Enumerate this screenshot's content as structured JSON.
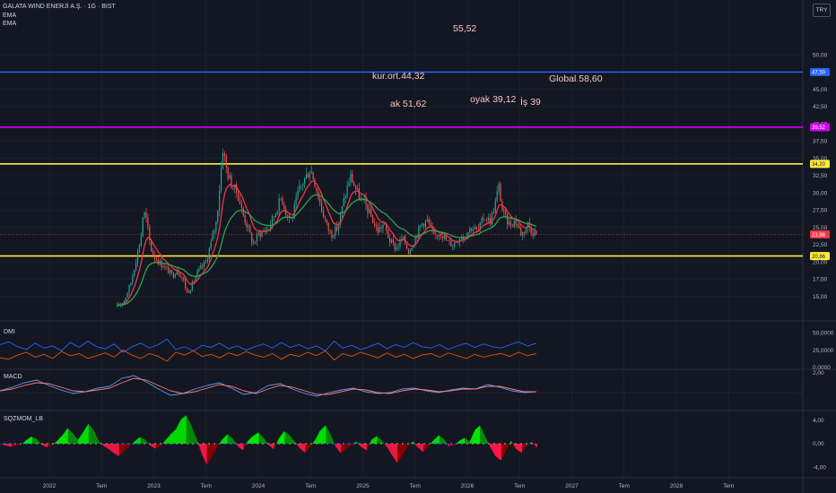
{
  "header": {
    "symbol": "GALATA WIND ENERJİ A.Ş. · 1G · BIST",
    "ind1": "EMA",
    "ind2": "EMA",
    "currency": "TRY"
  },
  "colors": {
    "background": "#131722",
    "grid": "#1e222d",
    "candle_up": "#26a69a",
    "candle_down": "#ef5350",
    "ema_fast": "#f23645",
    "ema_slow": "#2ea44f",
    "blue_line": "#2962ff",
    "purple_line": "#d500f9",
    "yellow_line": "#ffeb3b",
    "dmi_plus": "#2962ff",
    "dmi_minus": "#e65100",
    "macd": "#5b9cf6",
    "signal": "#ff7a7a",
    "sqz_up": "#00e600",
    "sqz_down": "#ff1744"
  },
  "chart_data": [
    {
      "type": "candlestick",
      "title": "GALATA WIND ENERJİ A.Ş. · 1G · BIST",
      "x_ticks": [
        "2022",
        "Tem",
        "2023",
        "Tem",
        "2024",
        "Tem",
        "2025",
        "Tem",
        "2026",
        "Tem",
        "2027",
        "Tem",
        "2028",
        "Tem"
      ],
      "y_ticks": [
        "50,00",
        "47,50",
        "45,00",
        "42,50",
        "40,00",
        "37,50",
        "35,00",
        "32,50",
        "30,00",
        "27,50",
        "25,00",
        "22,50",
        "20,00",
        "17,50",
        "15,00"
      ],
      "ylim": [
        12.5,
        53
      ],
      "price_path": [
        [
          2022.65,
          13.5
        ],
        [
          2022.72,
          14.5
        ],
        [
          2022.78,
          17
        ],
        [
          2022.84,
          21
        ],
        [
          2022.88,
          24
        ],
        [
          2022.9,
          27.5
        ],
        [
          2022.93,
          26
        ],
        [
          2022.97,
          22
        ],
        [
          2023.0,
          21
        ],
        [
          2023.05,
          20
        ],
        [
          2023.12,
          19
        ],
        [
          2023.18,
          18
        ],
        [
          2023.22,
          19
        ],
        [
          2023.28,
          17.5
        ],
        [
          2023.32,
          15.5
        ],
        [
          2023.36,
          16.5
        ],
        [
          2023.42,
          18.5
        ],
        [
          2023.5,
          20
        ],
        [
          2023.55,
          23
        ],
        [
          2023.6,
          26
        ],
        [
          2023.63,
          31
        ],
        [
          2023.66,
          36.5
        ],
        [
          2023.7,
          33
        ],
        [
          2023.75,
          31
        ],
        [
          2023.8,
          30
        ],
        [
          2023.85,
          27
        ],
        [
          2023.9,
          25
        ],
        [
          2023.95,
          22.5
        ],
        [
          2024.0,
          24
        ],
        [
          2024.05,
          24.5
        ],
        [
          2024.1,
          25
        ],
        [
          2024.16,
          27
        ],
        [
          2024.22,
          29.5
        ],
        [
          2024.27,
          27
        ],
        [
          2024.32,
          26
        ],
        [
          2024.38,
          30
        ],
        [
          2024.44,
          32
        ],
        [
          2024.5,
          33.5
        ],
        [
          2024.55,
          31
        ],
        [
          2024.6,
          28
        ],
        [
          2024.66,
          25
        ],
        [
          2024.7,
          24
        ],
        [
          2024.76,
          25
        ],
        [
          2024.82,
          29
        ],
        [
          2024.88,
          32.5
        ],
        [
          2024.92,
          31
        ],
        [
          2024.98,
          29
        ],
        [
          2025.02,
          28.5
        ],
        [
          2025.08,
          26.5
        ],
        [
          2025.14,
          24.5
        ],
        [
          2025.2,
          25.5
        ],
        [
          2025.26,
          23
        ],
        [
          2025.32,
          22
        ],
        [
          2025.38,
          23.5
        ],
        [
          2025.44,
          21.5
        ],
        [
          2025.5,
          23.5
        ],
        [
          2025.56,
          25.5
        ],
        [
          2025.62,
          26
        ],
        [
          2025.68,
          23.5
        ],
        [
          2025.74,
          24.5
        ],
        [
          2025.8,
          23
        ],
        [
          2025.86,
          22.5
        ],
        [
          2025.92,
          23.5
        ],
        [
          2025.98,
          24
        ],
        [
          2026.04,
          25
        ],
        [
          2026.1,
          24.5
        ],
        [
          2026.16,
          26.5
        ],
        [
          2026.22,
          26
        ],
        [
          2026.26,
          28
        ],
        [
          2026.3,
          31
        ],
        [
          2026.34,
          27
        ],
        [
          2026.4,
          25.5
        ],
        [
          2026.46,
          26
        ],
        [
          2026.52,
          24
        ],
        [
          2026.58,
          25.5
        ],
        [
          2026.62,
          24.5
        ],
        [
          2026.66,
          23.98
        ]
      ],
      "current_price": "23,98",
      "annotations": [
        "55,52",
        "kur.ort.44,32",
        "Global 58,60",
        "ak 51,62",
        "oyak 39,12",
        "İş 39"
      ],
      "hlines": [
        {
          "value": 47.5,
          "tag": "47,50",
          "color": "#2962ff"
        },
        {
          "value": 39.52,
          "tag": "39,52",
          "color": "#d500f9"
        },
        {
          "value": 34.2,
          "tag": "34,20",
          "color": "#ffeb3b"
        },
        {
          "value": 20.86,
          "tag": "20,86",
          "color": "#ffeb3b"
        }
      ]
    },
    {
      "type": "line",
      "title": "DMI",
      "y_ticks": [
        "50,0000",
        "25,0000",
        "0,0000"
      ],
      "ylim": [
        0,
        62
      ],
      "series": [
        {
          "name": "+DI",
          "color": "#2962ff",
          "values": [
            33,
            37,
            30,
            26,
            35,
            28,
            31,
            24,
            36,
            29,
            38,
            30,
            27,
            34,
            22,
            30,
            35,
            28,
            33,
            41,
            26,
            30,
            24,
            32,
            29,
            35,
            27,
            31,
            25,
            30,
            34,
            28,
            36,
            29,
            33,
            27,
            31,
            24,
            38,
            28,
            32,
            26,
            30,
            35,
            27,
            33,
            29,
            36,
            30,
            28,
            33,
            26,
            31,
            35,
            29,
            34,
            30,
            28,
            33,
            37,
            31,
            35
          ]
        },
        {
          "name": "-DI",
          "color": "#e65100",
          "values": [
            14,
            12,
            18,
            22,
            15,
            19,
            13,
            23,
            17,
            20,
            13,
            17,
            21,
            15,
            25,
            18,
            13,
            20,
            16,
            9,
            22,
            18,
            24,
            16,
            19,
            14,
            21,
            17,
            23,
            18,
            15,
            20,
            12,
            19,
            16,
            22,
            17,
            24,
            11,
            20,
            16,
            22,
            18,
            14,
            21,
            15,
            19,
            13,
            18,
            20,
            15,
            21,
            17,
            13,
            19,
            15,
            18,
            20,
            16,
            22,
            17,
            20
          ]
        }
      ]
    },
    {
      "type": "line",
      "title": "MACD",
      "y_ticks": [
        "2,00"
      ],
      "ylim": [
        -2,
        2.2
      ],
      "series": [
        {
          "name": "MACD",
          "color": "#5b9cf6",
          "values": [
            0,
            0.4,
            0.9,
            1.2,
            0.6,
            0.1,
            -0.3,
            -0.1,
            0.3,
            0.5,
            1.4,
            1.7,
            1.0,
            0.2,
            -0.5,
            -0.3,
            0.2,
            0.6,
            0.9,
            0.3,
            -0.4,
            -0.2,
            0.6,
            0.8,
            0.2,
            -0.3,
            -0.6,
            -0.2,
            0.1,
            0.3,
            -0.1,
            -0.3,
            -0.2,
            0.2,
            0.3,
            0,
            -0.2,
            0.1,
            0.3,
            0.2,
            0.7,
            0.4,
            0,
            -0.2,
            -0.1
          ]
        },
        {
          "name": "Signal",
          "color": "#ff7a7a",
          "values": [
            0,
            0.2,
            0.6,
            0.9,
            0.8,
            0.4,
            0,
            -0.1,
            0.1,
            0.3,
            0.9,
            1.4,
            1.2,
            0.6,
            0,
            -0.3,
            -0.1,
            0.3,
            0.7,
            0.5,
            0,
            -0.3,
            0.2,
            0.6,
            0.4,
            0,
            -0.4,
            -0.4,
            -0.1,
            0.2,
            0.1,
            -0.2,
            -0.3,
            0,
            0.2,
            0.1,
            -0.1,
            0,
            0.2,
            0.2,
            0.5,
            0.5,
            0.2,
            -0.1,
            -0.1
          ]
        }
      ]
    },
    {
      "type": "bar",
      "title": "SQZMOM_LB",
      "y_ticks": [
        "4,00",
        "0,00",
        "-4,00"
      ],
      "ylim": [
        -5.3,
        5.3
      ],
      "series": [
        {
          "name": "momentum",
          "values": [
            0,
            -0.3,
            -0.5,
            -0.4,
            -0.2,
            0.6,
            1.2,
            0.8,
            -0.2,
            -0.6,
            -0.3,
            0.5,
            1.4,
            2.6,
            1.8,
            0.6,
            1.9,
            3.3,
            2.4,
            0.5,
            -0.4,
            -0.9,
            -1.6,
            -2.1,
            -1.2,
            -0.5,
            0.4,
            1.1,
            0.7,
            -0.3,
            -0.8,
            -0.5,
            0.6,
            1.6,
            2.4,
            4.1,
            4.8,
            3.1,
            0.9,
            -1.6,
            -3.6,
            -2.2,
            -0.6,
            0.7,
            1.6,
            0.9,
            -0.4,
            -1.1,
            0.5,
            1.3,
            1.9,
            1.0,
            -0.2,
            -0.9,
            0.9,
            2.1,
            1.5,
            0.4,
            -0.7,
            -1.5,
            -0.6,
            0.6,
            2.2,
            3.1,
            1.6,
            -0.5,
            -1.6,
            -0.9,
            -0.3,
            0.4,
            -0.6,
            -1.1,
            0.7,
            1.3,
            0.5,
            -0.6,
            -2.0,
            -3.3,
            -1.9,
            -0.4,
            0.4,
            -0.7,
            -1.4,
            -0.5,
            0.6,
            1.4,
            0.8,
            -0.5,
            -0.3,
            0.5,
            1.0,
            0.3,
            2.3,
            3.1,
            1.2,
            -0.6,
            -2.1,
            -2.8,
            -1.3,
            0.5,
            -0.9,
            -1.5,
            -0.4,
            0.3,
            -0.6
          ]
        }
      ]
    }
  ]
}
